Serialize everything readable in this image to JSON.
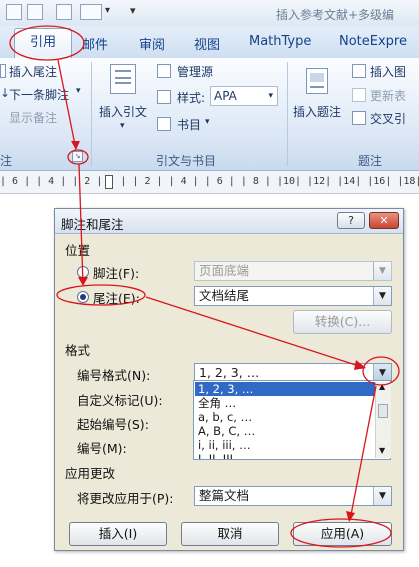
{
  "window": {
    "title": "插入参考文献+多级编",
    "qat_arrow": "▾"
  },
  "tabs": {
    "active": "引用",
    "items": [
      "邮件",
      "审阅",
      "视图",
      "MathType",
      "NoteExpre"
    ]
  },
  "ribbon": {
    "footnote_group": {
      "insert_endnote": "插入尾注",
      "next_footnote": "下一条脚注",
      "show_notes": "显示备注",
      "label": "注"
    },
    "citations_group": {
      "insert_citation": "插入引文",
      "manage_sources": "管理源",
      "style_label": "样式:",
      "style_value": "APA",
      "bibliography": "书目",
      "label": "引文与书目"
    },
    "captions_group": {
      "insert_caption": "插入题注",
      "insert_table_of_figures": "插入图",
      "update_table": "更新表",
      "cross_reference": "交叉引",
      "label": "题注"
    }
  },
  "ruler": {
    "text": "| 6 | | 4 | | 2 |   | | 2 | | 4 | | 6 | | 8 | |10| |12| |14| |16| |18|"
  },
  "dialog": {
    "title": "脚注和尾注",
    "help": "?",
    "close": "✕",
    "location_section": "位置",
    "footnote_label": "脚注(F):",
    "footnote_value": "页面底端",
    "endnote_label": "尾注(E):",
    "endnote_value": "文档结尾",
    "convert_button": "转换(C)...",
    "format_section": "格式",
    "number_format_label": "编号格式(N):",
    "number_format_value": "1, 2, 3, …",
    "custom_mark_label": "自定义标记(U):",
    "start_at_label": "起始编号(S):",
    "numbering_label": "编号(M):",
    "number_format_options": [
      "1, 2, 3, …",
      "全角 …",
      "a, b, c, …",
      "A, B, C, …",
      "i, ii, iii, …",
      "I, II, III, …"
    ],
    "apply_changes_section": "应用更改",
    "apply_to_label": "将更改应用于(P):",
    "apply_to_value": "整篇文档",
    "insert_button": "插入(I)",
    "cancel_button": "取消",
    "apply_button": "应用(A)"
  },
  "colors": {
    "annotation": "#d8161c",
    "ribbon_text": "#1e3966",
    "selection": "#316ac5"
  }
}
